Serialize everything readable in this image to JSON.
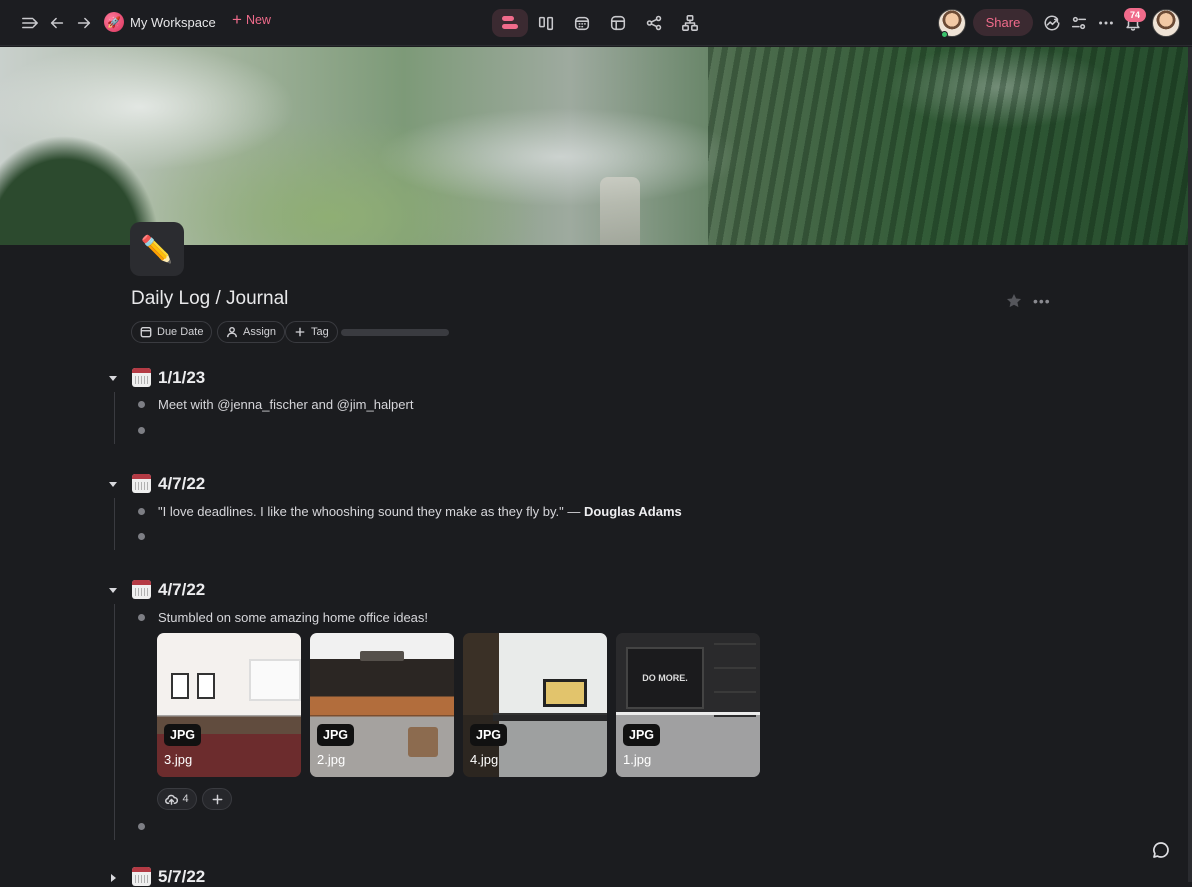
{
  "topbar": {
    "workspace_name": "My Workspace",
    "new_label": "New",
    "share_label": "Share",
    "notification_count": "74",
    "icons": [
      "sidebar-toggle-icon",
      "back-arrow-icon",
      "forward-arrow-icon",
      "workspace-logo-icon",
      "outline-view-icon",
      "board-view-icon",
      "calendar-view-icon",
      "table-view-icon",
      "mindmap-view-icon",
      "diagram-view-icon",
      "avatar",
      "activity-icon",
      "settings-sliders-icon",
      "more-icon",
      "notifications-icon"
    ]
  },
  "page": {
    "icon_emoji": "✏️",
    "title": "Daily Log / Journal",
    "chips": {
      "due_date": "Due Date",
      "assign": "Assign",
      "tag": "Tag"
    }
  },
  "entries": [
    {
      "date": "1/1/23",
      "line": "Meet with @jenna_fischer and @jim_halpert"
    },
    {
      "date": "4/7/22",
      "quote": "\"I love deadlines. I like the whooshing sound they make as they fly by.\" —",
      "author": "Douglas Adams"
    },
    {
      "date": "4/7/22",
      "line": "Stumbled on some amazing home office ideas!",
      "attachments": [
        {
          "type": "JPG",
          "name": "3.jpg"
        },
        {
          "type": "JPG",
          "name": "2.jpg"
        },
        {
          "type": "JPG",
          "name": "4.jpg"
        },
        {
          "type": "JPG",
          "name": "1.jpg",
          "screen_text": "DO MORE."
        }
      ],
      "upload_count": "4"
    },
    {
      "date": "5/7/22"
    }
  ]
}
